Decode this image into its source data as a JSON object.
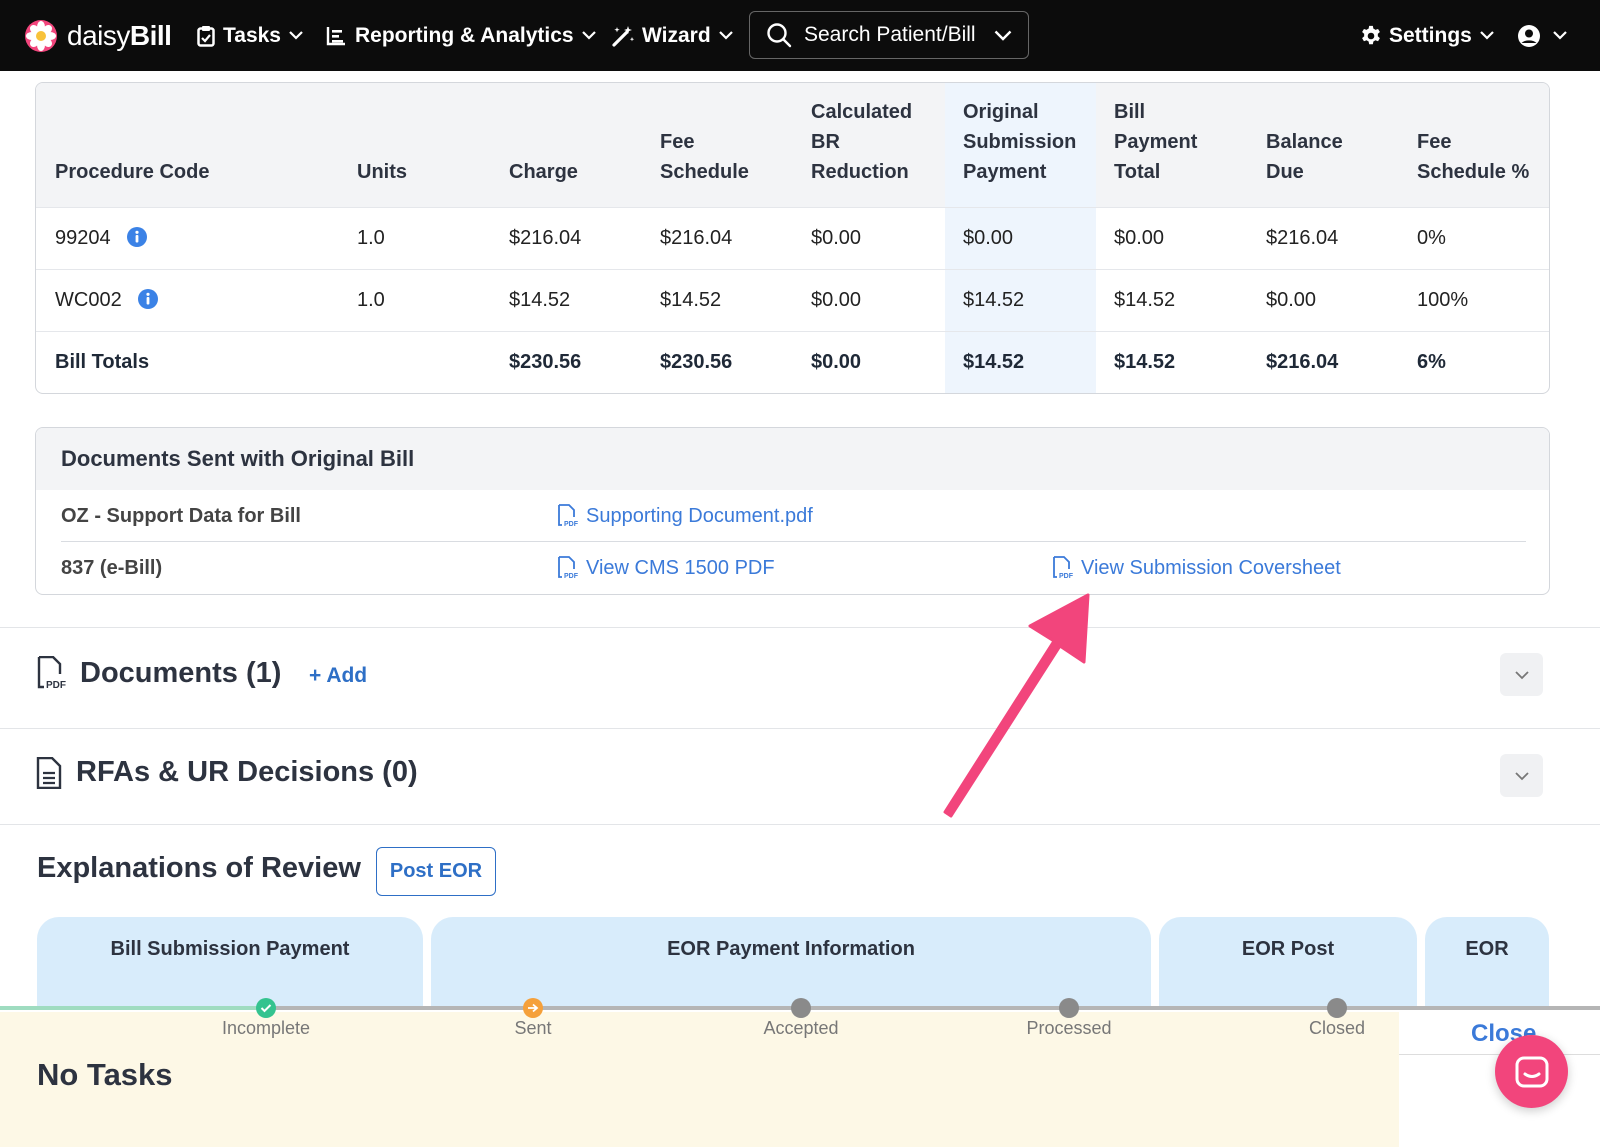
{
  "nav": {
    "logo_prefix": "daisy",
    "logo_suffix": "Bill",
    "tasks": "Tasks",
    "reporting": "Reporting & Analytics",
    "wizard": "Wizard",
    "search_placeholder": "Search Patient/Bill",
    "settings": "Settings"
  },
  "procedure_table": {
    "headers": {
      "procedure_code": "Procedure Code",
      "units": "Units",
      "charge": "Charge",
      "fee_schedule": [
        "Fee",
        "Schedule"
      ],
      "br_reduction": [
        "Calculated",
        "BR",
        "Reduction"
      ],
      "orig_payment": [
        "Original",
        "Submission",
        "Payment"
      ],
      "bill_payment": [
        "Bill",
        "Payment",
        "Total"
      ],
      "balance_due": [
        "Balance",
        "Due"
      ],
      "fee_pct": [
        "Fee",
        "Schedule %"
      ]
    },
    "rows": [
      {
        "code": "99204",
        "units": "1.0",
        "charge": "$216.04",
        "fee_schedule": "$216.04",
        "br_reduction": "$0.00",
        "orig_payment": "$0.00",
        "bill_payment": "$0.00",
        "balance_due": "$216.04",
        "fee_pct": "0%"
      },
      {
        "code": "WC002",
        "units": "1.0",
        "charge": "$14.52",
        "fee_schedule": "$14.52",
        "br_reduction": "$0.00",
        "orig_payment": "$14.52",
        "bill_payment": "$14.52",
        "balance_due": "$0.00",
        "fee_pct": "100%"
      }
    ],
    "totals": {
      "label": "Bill Totals",
      "charge": "$230.56",
      "fee_schedule": "$230.56",
      "br_reduction": "$0.00",
      "orig_payment": "$14.52",
      "bill_payment": "$14.52",
      "balance_due": "$216.04",
      "fee_pct": "6%"
    }
  },
  "documents_sent": {
    "title": "Documents Sent with Original Bill",
    "rows": [
      {
        "label": "OZ - Support Data for Bill",
        "links": [
          "Supporting Document.pdf"
        ]
      },
      {
        "label": "837 (e-Bill)",
        "links": [
          "View CMS 1500 PDF",
          "View Submission Coversheet"
        ]
      }
    ]
  },
  "documents_section": {
    "title": "Documents (1)",
    "add_label": "+ Add"
  },
  "rfa_section": {
    "title": "RFAs & UR Decisions (0)"
  },
  "eor": {
    "title": "Explanations of Review",
    "post_button": "Post EOR",
    "tabs": [
      "Bill Submission Payment",
      "EOR Payment Information",
      "EOR Post",
      "EOR"
    ]
  },
  "status": {
    "steps": [
      "Incomplete",
      "Sent",
      "Accepted",
      "Processed",
      "Closed"
    ],
    "colors": {
      "complete": "#34c38f",
      "current": "#f5a03a",
      "pending": "#8a8a8a"
    }
  },
  "tasks": {
    "title": "No Tasks",
    "close_label": "Close"
  },
  "colors": {
    "accent": "#2e6fc6",
    "link": "#3b7ad9",
    "annotation": "#f2457c"
  }
}
